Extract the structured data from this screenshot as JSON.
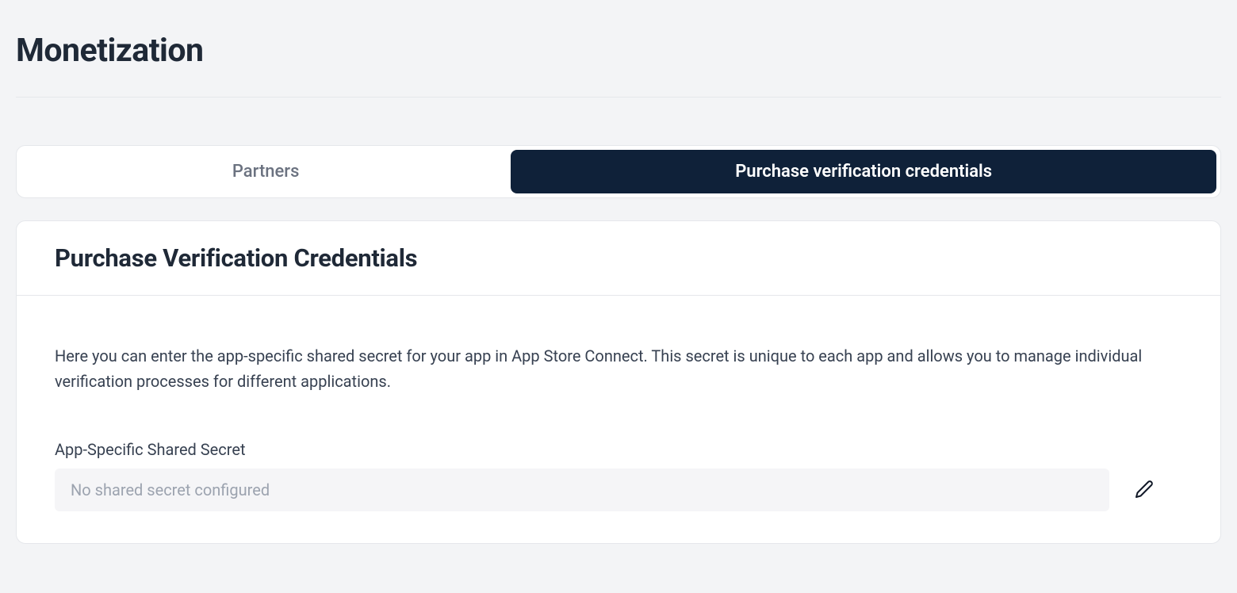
{
  "page": {
    "title": "Monetization"
  },
  "tabs": {
    "partners": {
      "label": "Partners"
    },
    "credentials": {
      "label": "Purchase verification credentials"
    }
  },
  "card": {
    "title": "Purchase Verification Credentials",
    "description": "Here you can enter the app-specific shared secret for your app in App Store Connect. This secret is unique to each app and allows you to manage individual verification processes for different applications.",
    "field": {
      "label": "App-Specific Shared Secret",
      "placeholder": "No shared secret configured",
      "value": ""
    }
  }
}
